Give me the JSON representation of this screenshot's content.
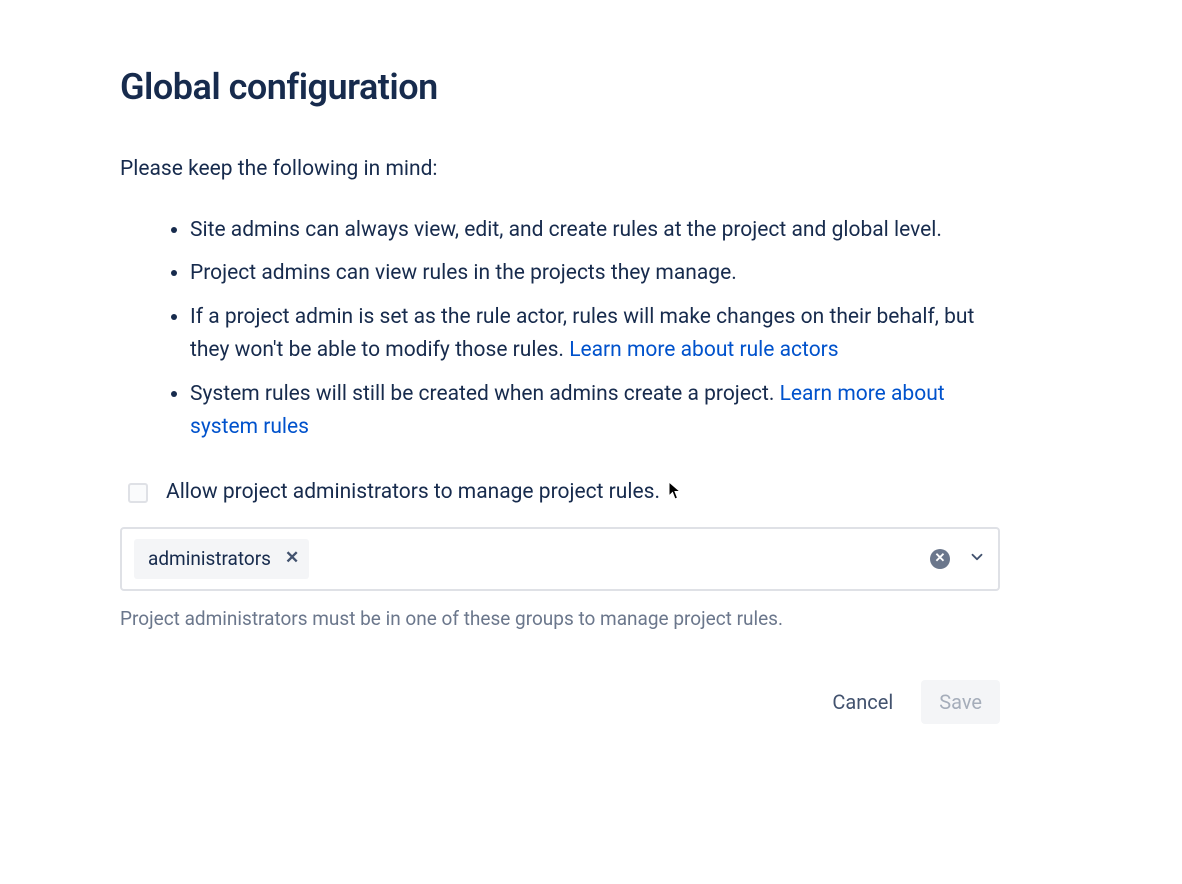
{
  "page": {
    "title": "Global configuration",
    "intro": "Please keep the following in mind:",
    "bullets": [
      {
        "text": "Site admins can always view, edit, and create rules at the project and global level."
      },
      {
        "text": "Project admins can view rules in the projects they manage."
      },
      {
        "text": "If a project admin is set as the rule actor, rules will make changes on their behalf, but they won't be able to modify those rules. ",
        "link": "Learn more about rule actors"
      },
      {
        "text": "System rules will still be created when admins create a project. ",
        "link": "Learn more about system rules"
      }
    ],
    "checkbox": {
      "label": "Allow project administrators to manage project rules.",
      "checked": false
    },
    "groupSelect": {
      "tags": [
        "administrators"
      ],
      "helper": "Project administrators must be in one of these groups to manage project rules."
    },
    "actions": {
      "cancel": "Cancel",
      "save": "Save"
    }
  }
}
